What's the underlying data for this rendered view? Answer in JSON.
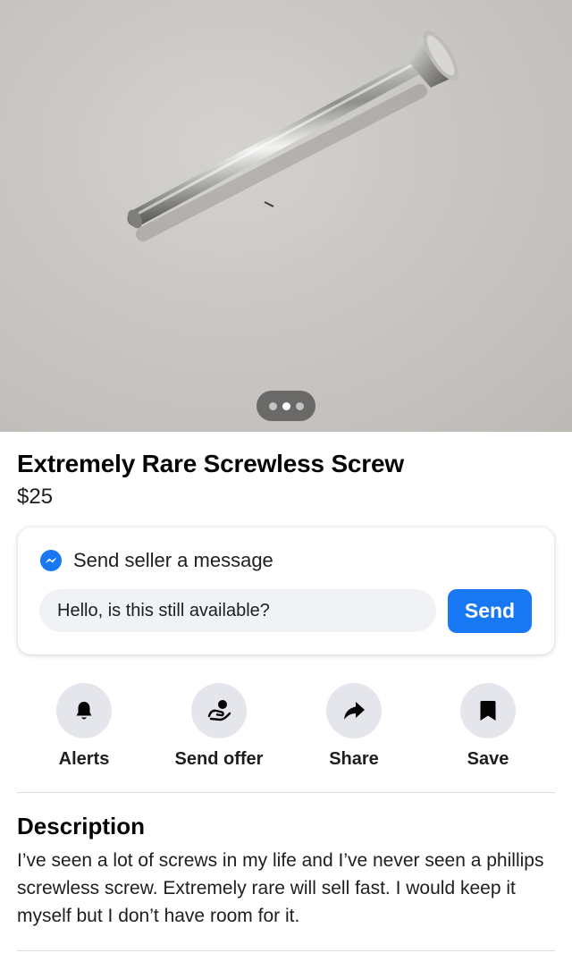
{
  "listing": {
    "title": "Extremely Rare Screwless Screw",
    "price": "$25"
  },
  "message_card": {
    "heading": "Send seller a message",
    "input_value": "Hello, is this still available?",
    "send_label": "Send"
  },
  "actions": [
    {
      "label": "Alerts",
      "icon": "bell-icon"
    },
    {
      "label": "Send offer",
      "icon": "offer-icon"
    },
    {
      "label": "Share",
      "icon": "share-icon"
    },
    {
      "label": "Save",
      "icon": "bookmark-icon"
    }
  ],
  "description": {
    "heading": "Description",
    "text": "I’ve seen a lot of screws in my life and I’ve never seen a phillips screwless screw. Extremely rare will sell fast. I would keep it myself but I don’t have room for it."
  },
  "photo": {
    "pager_count": 3,
    "pager_active_index": 1
  },
  "colors": {
    "accent": "#1877f2",
    "icon_circle": "#e4e6eb",
    "input_bg": "#f0f2f5"
  }
}
